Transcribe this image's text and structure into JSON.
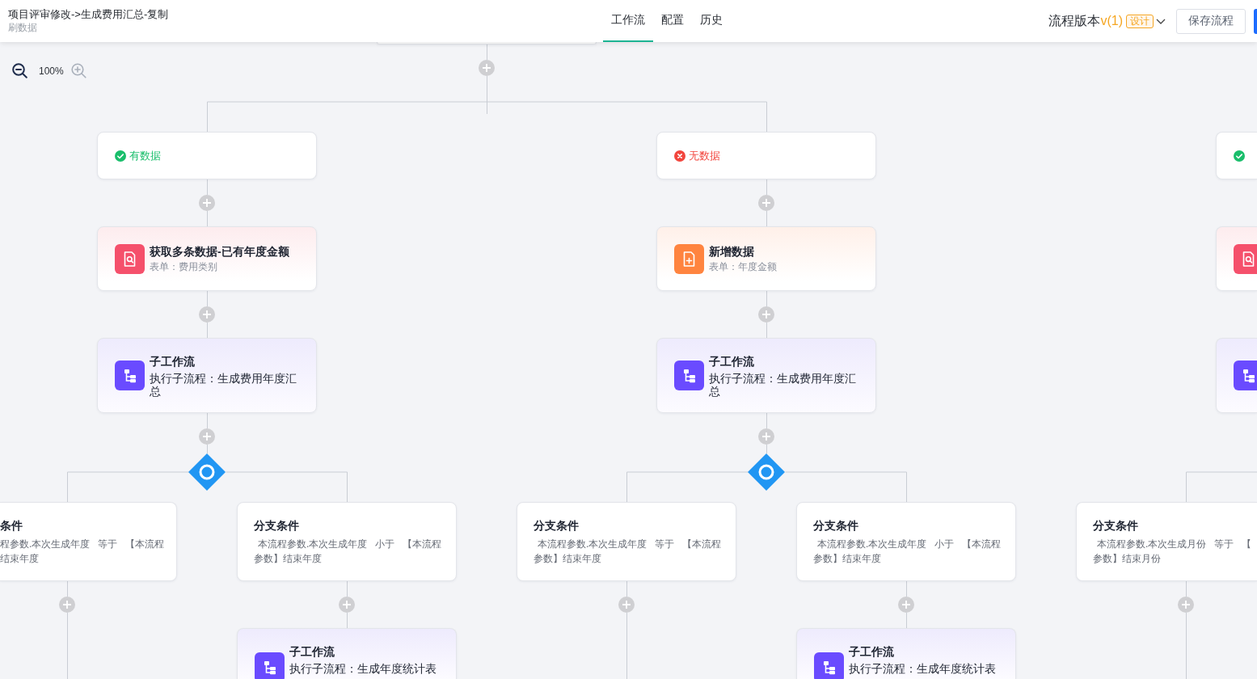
{
  "header": {
    "title": "项目评审修改->生成费用汇总-复制",
    "subtitle": "刷数据",
    "tabs": [
      {
        "label": "工作流",
        "selected": true
      },
      {
        "label": "配置",
        "selected": false
      },
      {
        "label": "历史",
        "selected": false
      }
    ],
    "version": {
      "label": "流程版本",
      "number": "v(1)",
      "badge": "设计"
    },
    "buttons": [
      {
        "kind": "default",
        "label": "保存流程"
      },
      {
        "kind": "primary"
      }
    ]
  },
  "zoom": {
    "zoom_out": {
      "disabled": false
    },
    "value": "100%",
    "zoom_in": {
      "disabled": true
    }
  },
  "flow": {
    "columns": [
      {
        "condition": {
          "kind": "success",
          "label": "有数据"
        },
        "steps": [
          {
            "kind": "get_data",
            "title": "获取多条数据-已有年度金额",
            "subtitle": "表单：费用类别"
          },
          {
            "kind": "subflow",
            "title": "子工作流",
            "description": "执行子流程：生成费用年度汇总"
          }
        ],
        "branches": [
          {
            "title": "条件",
            "condition": [
              "程参数.本次生成年度   等于   【本流程",
              "结束年度"
            ]
          },
          {
            "title": "分支条件",
            "condition": "本流程参数.本次生成年度   小于   【本流程参数】结束年度",
            "steps": [
              {
                "kind": "subflow",
                "title": "子工作流",
                "description": "执行子流程：生成年度统计表"
              }
            ]
          }
        ]
      },
      {
        "condition": {
          "kind": "fail",
          "label": "无数据"
        },
        "steps": [
          {
            "kind": "add_data",
            "title": "新增数据",
            "subtitle": "表单：年度金额"
          },
          {
            "kind": "subflow",
            "title": "子工作流",
            "description": "执行子流程：生成费用年度汇总"
          }
        ],
        "branches": [
          {
            "title": "分支条件",
            "condition": "本流程参数.本次生成年度   等于   【本流程参数】结束年度"
          },
          {
            "title": "分支条件",
            "condition": "本流程参数.本次生成年度   小于   【本流程参数】结束年度",
            "steps": [
              {
                "kind": "subflow",
                "title": "子工作流",
                "description": "执行子流程：生成年度统计表"
              }
            ]
          }
        ]
      },
      {
        "condition": {
          "kind": "success"
        },
        "steps": [
          {
            "kind": "get_data"
          },
          {
            "kind": "subflow"
          }
        ],
        "branches": [
          {
            "title": "分支条件",
            "condition": [
              "本流程参数.本次生成月份   等于   【",
              "参数】结束月份"
            ]
          }
        ]
      }
    ]
  }
}
